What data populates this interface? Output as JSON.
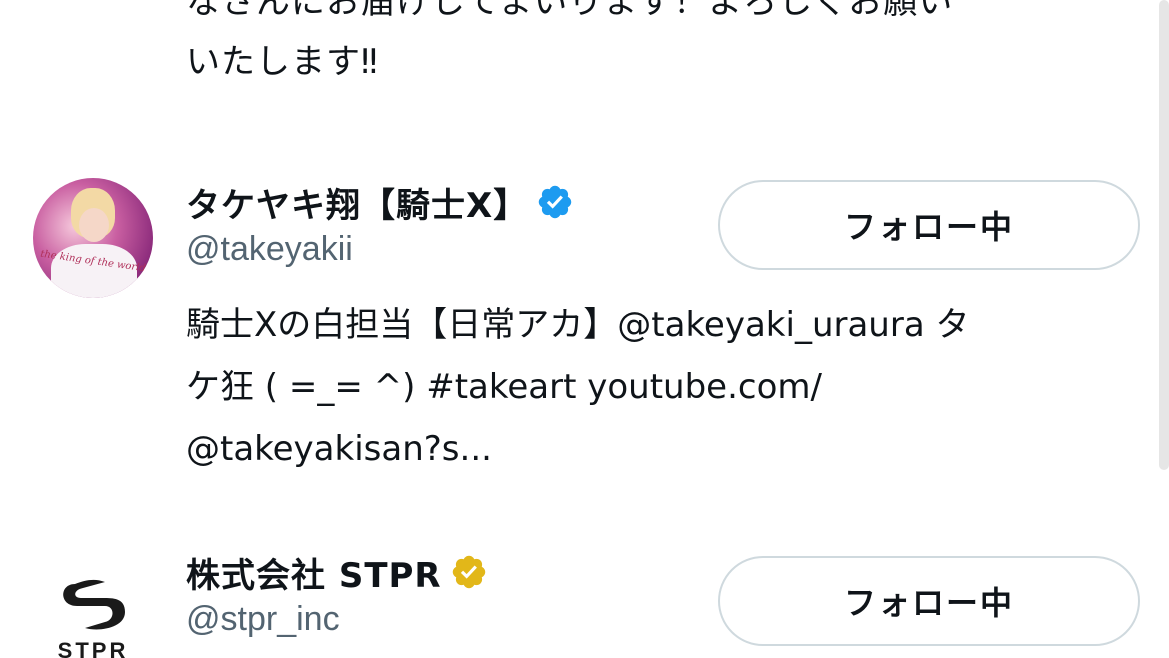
{
  "previous_bio": {
    "text": "なさんにお届けしてまいります！よろしくお願い\nいたします‼"
  },
  "users": [
    {
      "display_name": "タケヤキ翔【騎士X】",
      "handle": "@takeyakii",
      "bio": "騎士Xの白担当【日常アカ】@takeyaki_uraura タ\nケ狂 ( =_= ^) #takeart youtube.com/\n@takeyakisan?s...",
      "follow_label": "フォロー中",
      "badge": "verified-blue-badge",
      "badge_color": "#1d9bf0",
      "avatar": "profile-photo",
      "avatar_script": "the king of the world"
    },
    {
      "display_name": "株式会社 STPR",
      "handle": "@stpr_inc",
      "follow_label": "フォロー中",
      "badge": "verified-gold-badge",
      "badge_color": "#e2b719",
      "avatar": "stpr-logo",
      "avatar_text": "STPR"
    }
  ],
  "colors": {
    "text_primary": "#0f1419",
    "text_secondary": "#536471",
    "button_border": "#cfd9de"
  }
}
